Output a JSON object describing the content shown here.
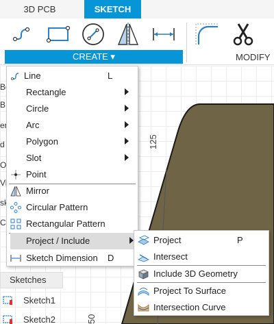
{
  "tabs": [
    {
      "label": "3D PCB",
      "active": false
    },
    {
      "label": "SKETCH",
      "active": true
    }
  ],
  "toolbar": {
    "create_label": "CREATE ▾",
    "modify_label": "MODIFY",
    "tools": [
      "line-icon",
      "rectangle-icon",
      "circle-icon",
      "mirror-icon",
      "sketch-dimension-icon",
      "fillet-icon",
      "scissors-icon"
    ]
  },
  "canvas": {
    "dimension_top": "125",
    "dimension_bottom": "50",
    "board_color": "#6f6446"
  },
  "browser": {
    "fragments": [
      "Bo",
      "B",
      "er",
      "d",
      "Or",
      "Vi",
      "sk",
      "Co"
    ],
    "sketches_header": "Sketches",
    "sketches": [
      {
        "label": "Sketch1"
      },
      {
        "label": "Sketch2"
      }
    ]
  },
  "menu": {
    "items": [
      {
        "label": "Line",
        "shortcut": "L",
        "submenu": false,
        "icon": "line-icon"
      },
      {
        "label": "Rectangle",
        "shortcut": "",
        "submenu": true,
        "icon": ""
      },
      {
        "label": "Circle",
        "shortcut": "",
        "submenu": true,
        "icon": ""
      },
      {
        "label": "Arc",
        "shortcut": "",
        "submenu": true,
        "icon": ""
      },
      {
        "label": "Polygon",
        "shortcut": "",
        "submenu": true,
        "icon": ""
      },
      {
        "label": "Slot",
        "shortcut": "",
        "submenu": true,
        "icon": ""
      },
      {
        "label": "Point",
        "shortcut": "",
        "submenu": false,
        "icon": "point-icon"
      },
      {
        "label": "Mirror",
        "shortcut": "",
        "submenu": false,
        "icon": "mirror-icon"
      },
      {
        "label": "Circular Pattern",
        "shortcut": "",
        "submenu": false,
        "icon": "circular-pattern-icon"
      },
      {
        "label": "Rectangular Pattern",
        "shortcut": "",
        "submenu": false,
        "icon": "rectangular-pattern-icon"
      },
      {
        "label": "Project / Include",
        "shortcut": "",
        "submenu": true,
        "icon": "",
        "highlighted": true
      },
      {
        "label": "Sketch Dimension",
        "shortcut": "D",
        "submenu": false,
        "icon": "sketch-dimension-icon"
      }
    ]
  },
  "submenu": {
    "items": [
      {
        "label": "Project",
        "shortcut": "P",
        "icon": "project-icon"
      },
      {
        "label": "Intersect",
        "shortcut": "",
        "icon": "intersect-icon"
      },
      {
        "label": "Include 3D Geometry",
        "shortcut": "",
        "icon": "include-3d-geometry-icon"
      },
      {
        "label": "Project To Surface",
        "shortcut": "",
        "icon": "project-to-surface-icon"
      },
      {
        "label": "Intersection Curve",
        "shortcut": "",
        "icon": "intersection-curve-icon"
      }
    ]
  },
  "colors": {
    "accent": "#0696d7",
    "highlight": "#dcdcdc"
  }
}
